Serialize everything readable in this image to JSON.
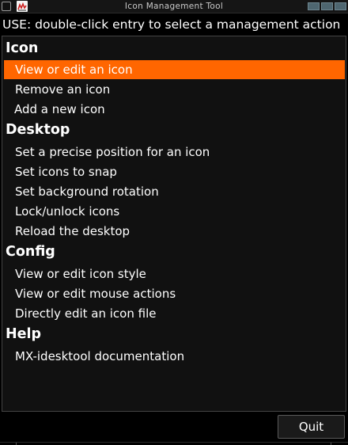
{
  "window": {
    "title": "Icon Management Tool"
  },
  "usage_text": "USE: double-click entry to select a management action",
  "sections": [
    {
      "header": "Icon",
      "items": [
        "View or edit an icon",
        "Remove an icon",
        "Add a new icon"
      ]
    },
    {
      "header": "Desktop",
      "items": [
        "Set a precise position for an icon",
        "Set icons to snap",
        "Set background rotation",
        "Lock/unlock icons",
        "Reload the desktop"
      ]
    },
    {
      "header": "Config",
      "items": [
        "View or edit icon style",
        "View or edit mouse actions",
        "Directly edit an icon file"
      ]
    },
    {
      "header": "Help",
      "items": [
        "MX-idesktool documentation"
      ]
    }
  ],
  "selected_item": "View or edit an icon",
  "quit_label": "Quit",
  "colors": {
    "selection": "#ff6600",
    "background": "#000000",
    "panel": "#111111",
    "titlebar_buttons": "#4e6670"
  },
  "icons": {
    "window_menu": "window-menu-icon",
    "app": "app-icon",
    "minimize": "minimize-icon",
    "maximize": "maximize-icon",
    "close": "close-icon"
  }
}
